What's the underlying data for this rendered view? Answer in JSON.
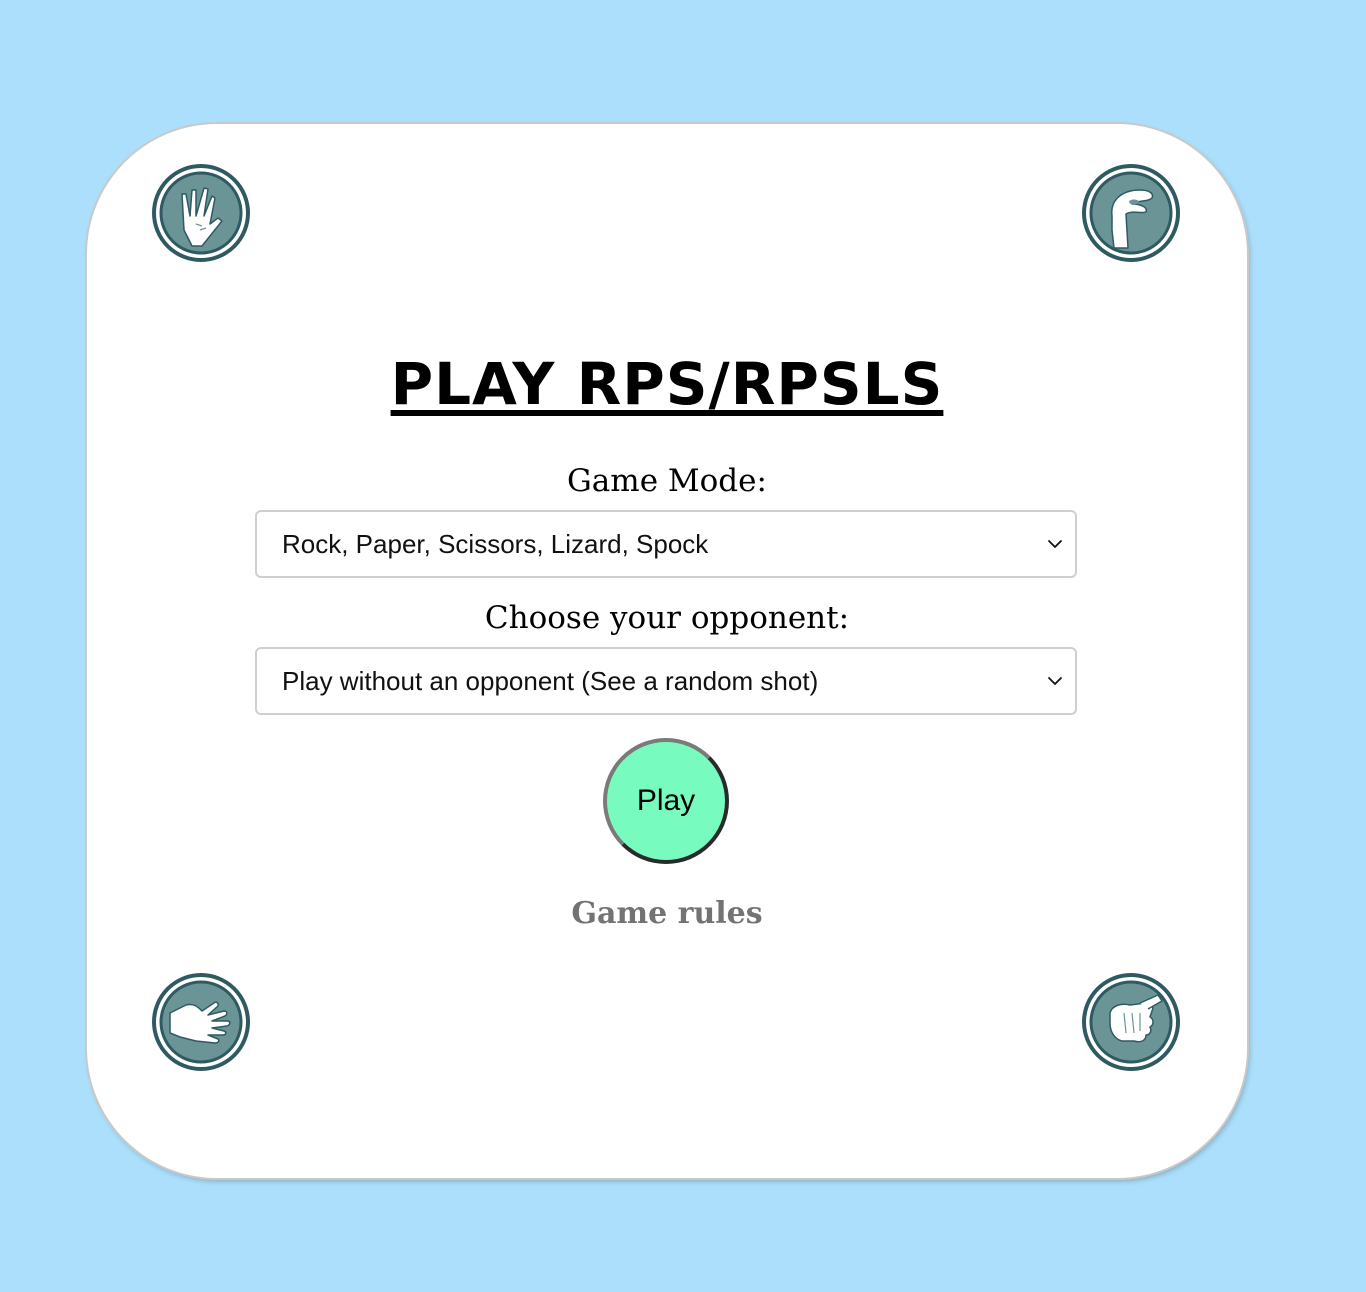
{
  "title": "PLAY RPS/RPSLS",
  "game_mode": {
    "label": "Game Mode:",
    "selected": "Rock, Paper, Scissors, Lizard, Spock"
  },
  "opponent": {
    "label": "Choose your opponent:",
    "selected": "Play without an opponent (See a random shot)"
  },
  "play_button": {
    "label": "Play"
  },
  "rules_link": {
    "label": "Game rules"
  },
  "corner_icons": [
    "spock-hand-icon",
    "lizard-hand-icon",
    "paper-hand-icon",
    "rock-fist-icon"
  ],
  "colors": {
    "background": "#abdffb",
    "card": "#ffffff",
    "icon_fill": "#6a9496",
    "icon_ring": "#2f5a62",
    "play_button": "#78fbbe",
    "rules_link": "#737373"
  }
}
